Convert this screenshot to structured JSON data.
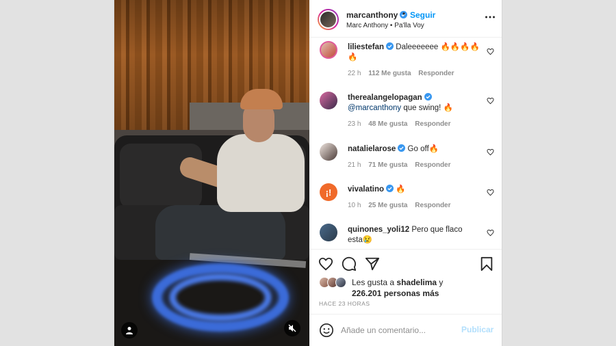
{
  "header": {
    "username": "marcanthony",
    "follow_label": "Seguir",
    "separator": "•",
    "subtitle": "Marc Anthony • Pa'lla Voy"
  },
  "comments": [
    {
      "user": "liliestefan",
      "verified": true,
      "text": "Daleeeeeee 🔥🔥🔥🔥🔥",
      "time": "22 h",
      "likes": "112 Me gusta",
      "reply": "Responder"
    },
    {
      "user": "therealangelopagan",
      "verified": true,
      "mention": "@marcanthony",
      "text": " que swing! 🔥",
      "time": "23 h",
      "likes": "48 Me gusta",
      "reply": "Responder"
    },
    {
      "user": "natalielarose",
      "verified": true,
      "text": "Go off🔥",
      "time": "21 h",
      "likes": "71 Me gusta",
      "reply": "Responder"
    },
    {
      "user": "vivalatino",
      "verified": true,
      "text": "🔥",
      "time": "10 h",
      "likes": "25 Me gusta",
      "reply": "Responder",
      "avatar_glyph": "¡!"
    },
    {
      "user": "quinones_yoli12",
      "verified": false,
      "text": "Pero que flaco esta😢",
      "time": "",
      "likes": "",
      "reply": ""
    }
  ],
  "likes": {
    "prefix": "Les gusta a ",
    "user": "shadelima",
    "middle": " y ",
    "count": "226.201 personas más"
  },
  "time_ago": "HACE 23 HORAS",
  "add_comment": {
    "placeholder": "Añade un comentario...",
    "publish_label": "Publicar"
  },
  "colors": {
    "link_blue": "#0095f6",
    "publish_disabled": "#b2dffc",
    "meta_gray": "#8e8e8e",
    "text": "#262626"
  },
  "icons": [
    "verified-badge-icon",
    "more-options-icon",
    "heart-icon",
    "comment-icon",
    "share-icon",
    "bookmark-icon",
    "emoji-icon",
    "user-tag-icon",
    "mute-icon"
  ]
}
